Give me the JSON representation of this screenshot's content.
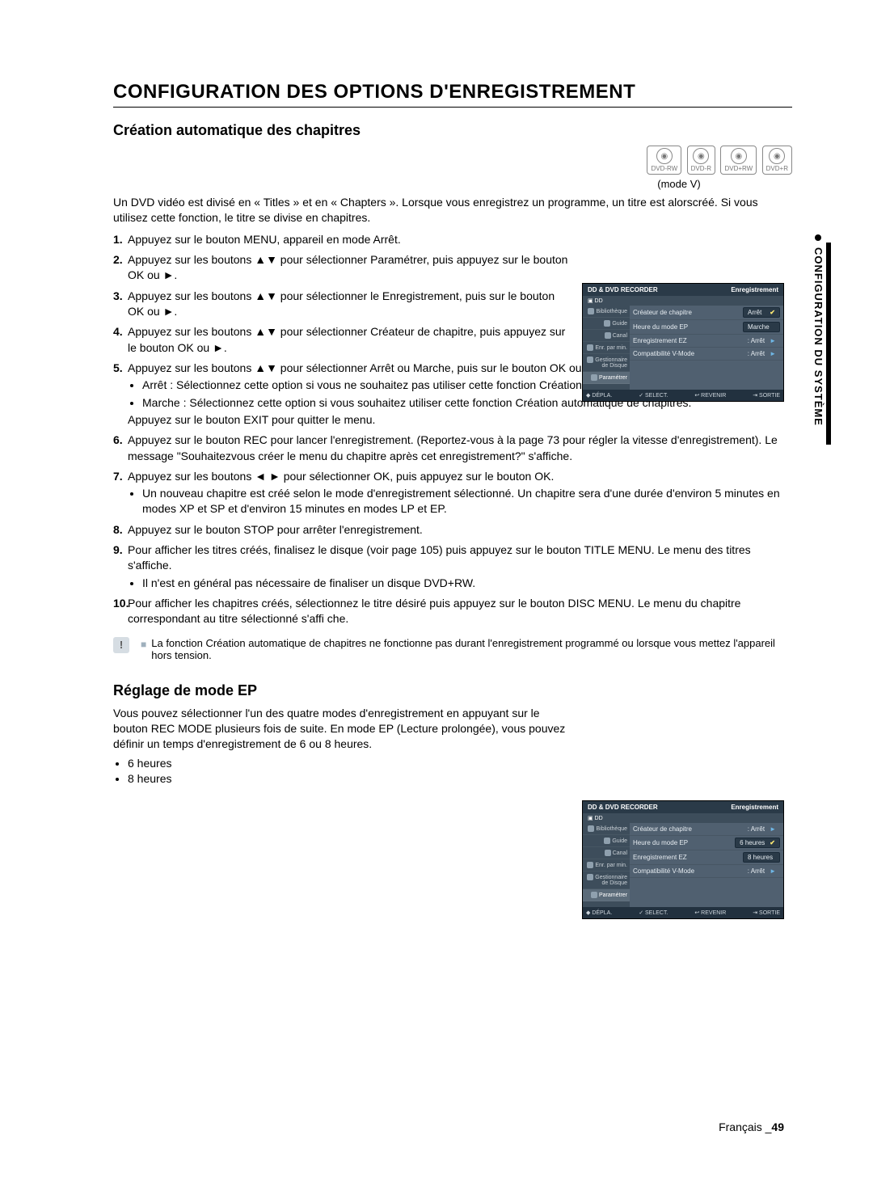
{
  "title": "CONFIGURATION DES OPTIONS D'ENREGISTREMENT",
  "section1": {
    "heading": "Création automatique des chapitres",
    "discs": [
      "DVD-RW",
      "DVD-R",
      "DVD+RW",
      "DVD+R"
    ],
    "mode": "(mode V)",
    "intro": "Un DVD vidéo est divisé en « Titles » et en « Chapters ». Lorsque vous enregistrez un programme, un titre est alorscréé. Si vous utilisez cette fonction, le titre se divise en chapitres.",
    "steps": {
      "s1": "Appuyez sur le bouton MENU, appareil en mode Arrêt.",
      "s2": "Appuyez sur les boutons ▲▼ pour sélectionner Paramétrer, puis appuyez sur le bouton OK ou ►.",
      "s3": "Appuyez sur les boutons ▲▼ pour sélectionner le Enregistrement, puis sur le bouton OK ou ►.",
      "s4": "Appuyez sur les boutons ▲▼ pour sélectionner Créateur de chapitre, puis appuyez sur le bouton OK ou ►.",
      "s5": "Appuyez sur les boutons ▲▼ pour sélectionner Arrêt ou Marche, puis sur le bouton OK ou ►.",
      "s5_b1": "Arrêt : Sélectionnez cette option si vous ne souhaitez pas utiliser cette fonction Création automatique de chapitres.",
      "s5_b2": "Marche : Sélectionnez cette option si vous souhaitez utiliser cette fonction Création automatique de chapitres.",
      "s5_exit": "Appuyez sur le bouton EXIT pour quitter le menu.",
      "s6": "Appuyez sur le bouton REC pour lancer l'enregistrement. (Reportez-vous à la page 73 pour régler la vitesse d'enregistrement). Le message \"Souhaitezvous créer le menu du chapitre après cet enregistrement?\" s'affiche.",
      "s7": "Appuyez sur les boutons ◄ ► pour sélectionner OK, puis appuyez sur le bouton OK.",
      "s7_b1": "Un nouveau chapitre est créé selon le mode d'enregistrement sélectionné. Un chapitre sera d'une durée d'environ 5 minutes en modes XP et SP et d'environ 15 minutes en modes LP et EP.",
      "s8": "Appuyez sur le bouton STOP pour arrêter l'enregistrement.",
      "s9": "Pour afficher les titres créés, finalisez le disque (voir page 105) puis appuyez sur le bouton TITLE MENU. Le menu des titres s'affiche.",
      "s9_b1": "Il n'est en général pas nécessaire de finaliser un disque DVD+RW.",
      "s10": "Pour afficher les chapitres créés, sélectionnez le titre désiré puis appuyez sur le bouton DISC MENU. Le menu du chapitre correspondant au titre sélectionné s'affi che."
    },
    "note": "La fonction Création automatique de chapitres ne fonctionne pas durant l'enregistrement programmé ou lorsque vous mettez l'appareil hors tension."
  },
  "section2": {
    "heading": "Réglage de mode EP",
    "text": "Vous pouvez sélectionner l'un des quatre modes d'enregistrement en appuyant sur le bouton REC MODE plusieurs fois de suite. En mode EP (Lecture prolongée), vous pouvez définir un temps d'enregistrement de 6 ou 8 heures.",
    "bullets": [
      "6 heures",
      "8 heures"
    ]
  },
  "osd": {
    "title_left": "DD & DVD RECORDER",
    "title_right": "Enregistrement",
    "sub": "▣ DD",
    "side": [
      "Bibliothèque",
      "Guide",
      "Canal",
      "Enr. par min.",
      "Gestionnaire de Disque",
      "Paramétrer"
    ],
    "row1_label": "Créateur de chapitre",
    "row2_label": "Heure du mode EP",
    "row3_label": "Enregistrement EZ",
    "row4_label": "Compatibilité V-Mode",
    "osd1": {
      "r1": "Arrêt",
      "r2": "Marche",
      "r3": ": Arrêt",
      "r4": ": Arrêt"
    },
    "osd2": {
      "r1": ": Arrêt",
      "r2": "6 heures",
      "r3": "8 heures",
      "r4": ": Arrêt"
    },
    "footer": {
      "f1": "◆ DÉPLA.",
      "f2": "✓ SELECT.",
      "f3": "↩ REVENIR",
      "f4": "⇥ SORTIE"
    }
  },
  "sidetab": "CONFIGURATION DU SYSTÈME",
  "footer": {
    "lang": "Français _",
    "page": "49"
  }
}
